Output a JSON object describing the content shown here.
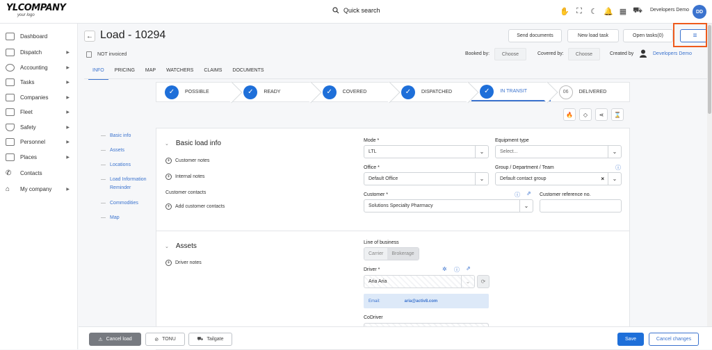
{
  "topbar": {
    "logo_main": "YLCOMPANY",
    "logo_sub": "your logo",
    "search_label": "Quick search",
    "icons": [
      "hand-icon",
      "fullscreen-icon",
      "moon-icon",
      "bell-icon",
      "grid-icon",
      "car-icon"
    ],
    "user_name": "Developers Demo",
    "avatar_initials": "DD"
  },
  "sidebar": {
    "items": [
      {
        "label": "Dashboard",
        "icon": "chart-icon",
        "arrow": false
      },
      {
        "label": "Dispatch",
        "icon": "send-icon",
        "arrow": true
      },
      {
        "label": "Accounting",
        "icon": "dollar-icon",
        "arrow": true
      },
      {
        "label": "Tasks",
        "icon": "tasks-icon",
        "arrow": true
      },
      {
        "label": "Companies",
        "icon": "building-icon",
        "arrow": true
      },
      {
        "label": "Fleet",
        "icon": "truck-icon",
        "arrow": true
      },
      {
        "label": "Safety",
        "icon": "shield-icon",
        "arrow": true
      },
      {
        "label": "Personnel",
        "icon": "id-card-icon",
        "arrow": true
      },
      {
        "label": "Places",
        "icon": "map-icon",
        "arrow": true
      },
      {
        "label": "Contacts",
        "icon": "phone-icon",
        "arrow": false
      },
      {
        "label": "My company",
        "icon": "home-icon",
        "arrow": true
      }
    ]
  },
  "header": {
    "title": "Load - 10294",
    "buttons": {
      "send": "Send documents",
      "new_task": "New load task",
      "open_tasks": "Open tasks(0)"
    },
    "status": "NOT invoiced",
    "booked_by": "Booked by:",
    "covered_by": "Covered by:",
    "choose": "Choose",
    "created_by": "Created by",
    "creator": "Developers Demo"
  },
  "tabs": [
    "INFO",
    "PRICING",
    "MAP",
    "WATCHERS",
    "CLAIMS",
    "DOCUMENTS"
  ],
  "steps": [
    {
      "label": "POSSIBLE",
      "done": true
    },
    {
      "label": "READY",
      "done": true
    },
    {
      "label": "COVERED",
      "done": true
    },
    {
      "label": "DISPATCHED",
      "done": true
    },
    {
      "label": "IN TRANSIT",
      "done": true
    },
    {
      "label": "DELIVERED",
      "done": false,
      "num": "06"
    }
  ],
  "anchors": [
    "Basic info",
    "Assets",
    "Locations",
    "Load Information Reminder",
    "Commodities",
    "Map"
  ],
  "basic": {
    "title": "Basic load info",
    "customer_notes": "Customer notes",
    "internal_notes": "Internal notes",
    "customer_contacts": "Customer contacts",
    "add_contacts": "Add customer contacts",
    "mode_label": "Mode *",
    "mode_value": "LTL",
    "equip_label": "Equipment type",
    "equip_placeholder": "Select...",
    "office_label": "Office *",
    "office_value": "Default Office",
    "group_label": "Group / Department / Team",
    "group_value": "Default contact group",
    "customer_label": "Customer *",
    "customer_value": "Solutions Specialty Pharmacy",
    "ref_label": "Customer reference no."
  },
  "assets": {
    "title": "Assets",
    "driver_notes": "Driver notes",
    "lob_label": "Line of business",
    "lob_options": [
      "Carrier",
      "Brokerage"
    ],
    "driver_label": "Driver *",
    "driver_value": "Aria Aria",
    "email_label": "Email:",
    "email_value": "aria@activ8.com",
    "codriver_label": "CoDriver"
  },
  "footer": {
    "cancel_load": "Cancel load",
    "tonu": "TONU",
    "tailgate": "Tailgate",
    "save": "Save",
    "cancel_changes": "Cancel changes"
  },
  "colors": {
    "accent": "#3b73ce",
    "step_check": "#1e6fd9",
    "highlight": "#ee5a1c",
    "cancel_load_bg": "#777a80"
  }
}
